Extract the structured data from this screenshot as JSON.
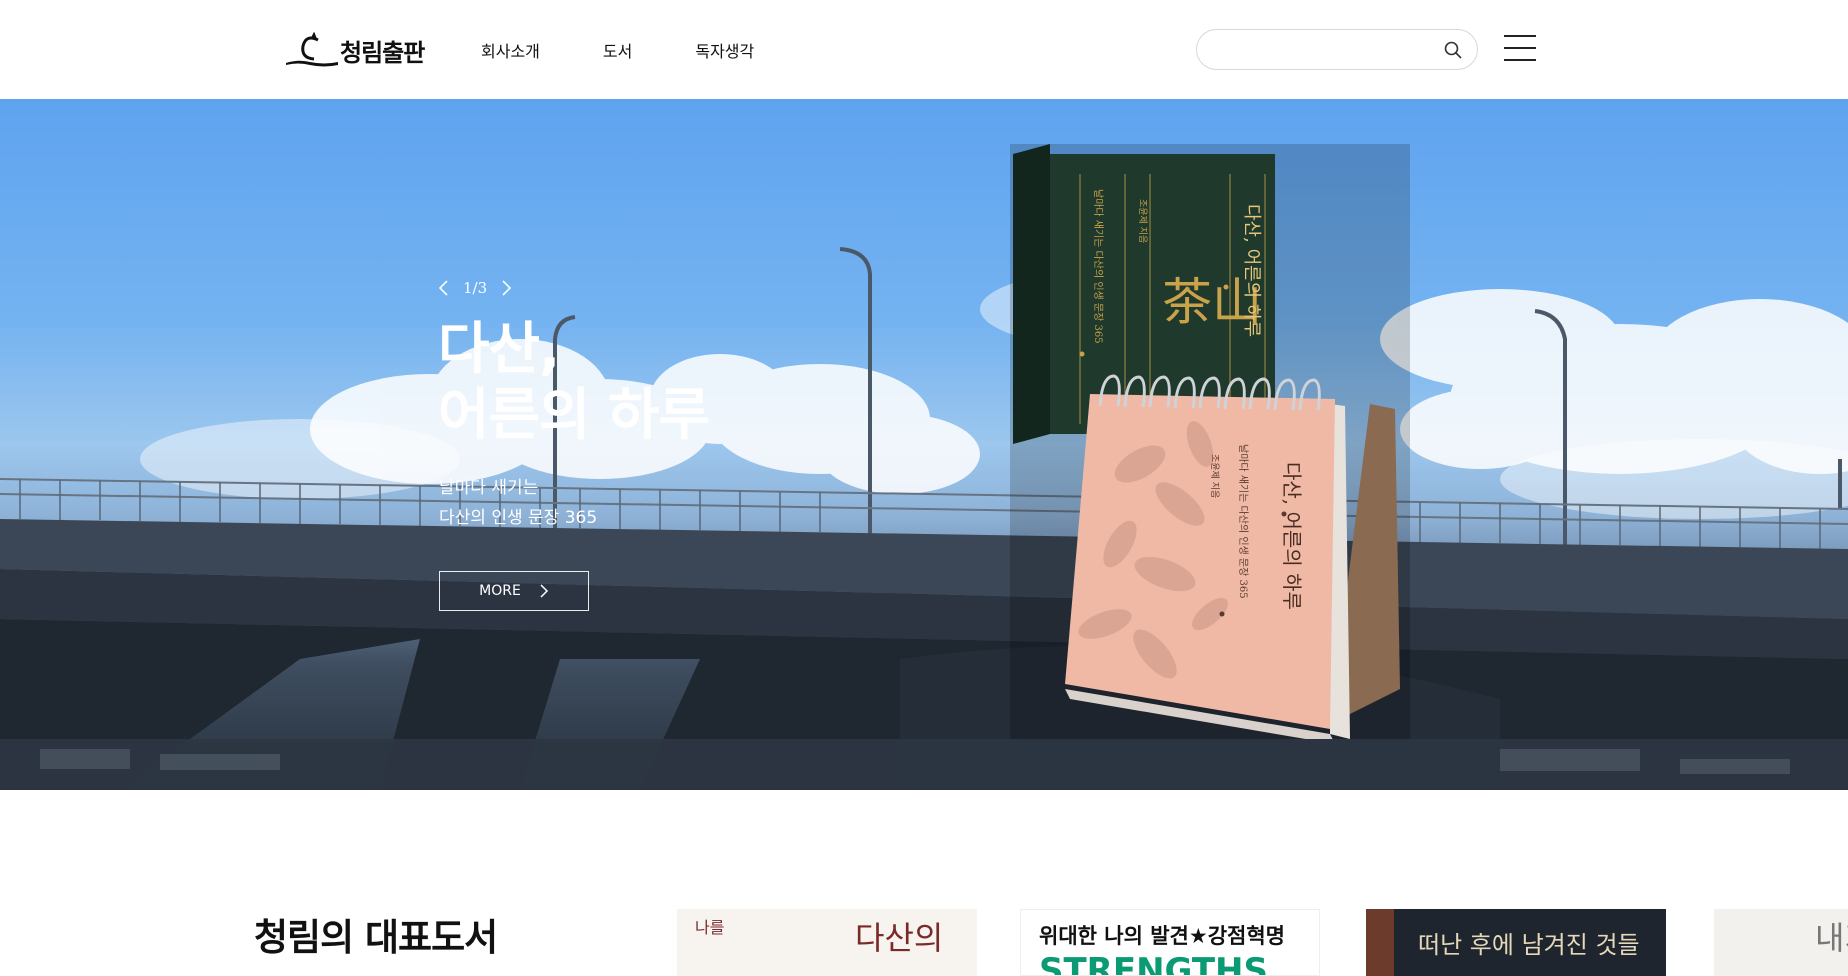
{
  "header": {
    "logo_text": "청림출판",
    "nav": [
      "회사소개",
      "도서",
      "독자생각"
    ],
    "search": {
      "value": "",
      "placeholder": ""
    }
  },
  "hero": {
    "slide_counter": "1/3",
    "title_line1": "다산,",
    "title_line2": "어른의 하루",
    "subtitle_line1": "날마다 새기는",
    "subtitle_line2": "다산의 인생 문장 365",
    "more_label": "MORE",
    "book": {
      "box_title": "다산, 어른의 하루",
      "box_subtitle": "날마다 새기는 다산의 인생 문장 365",
      "box_author": "조윤제 지음",
      "box_hanja": "茶山",
      "calendar_title": "다산, 어른의 하루",
      "calendar_subtitle": "날마다 새기는 다산의 인생 문장 365",
      "calendar_author": "조윤제 지음"
    }
  },
  "featured": {
    "title": "청림의 대표도서",
    "books": [
      {
        "side_text": "나를",
        "main_text": "다산의"
      },
      {
        "headline": "위대한 나의 발견★강점혁명",
        "sub": "STRENGTHS"
      },
      {
        "headline": "떠난 후에 남겨진 것들"
      },
      {
        "headline": "내가"
      }
    ]
  },
  "colors": {
    "sky_top": "#5fa3ef",
    "box_green": "#1f3a2d",
    "calendar_pink": "#efb9a6",
    "gold": "#c9a24a",
    "strengths_green": "#0a9a74"
  }
}
